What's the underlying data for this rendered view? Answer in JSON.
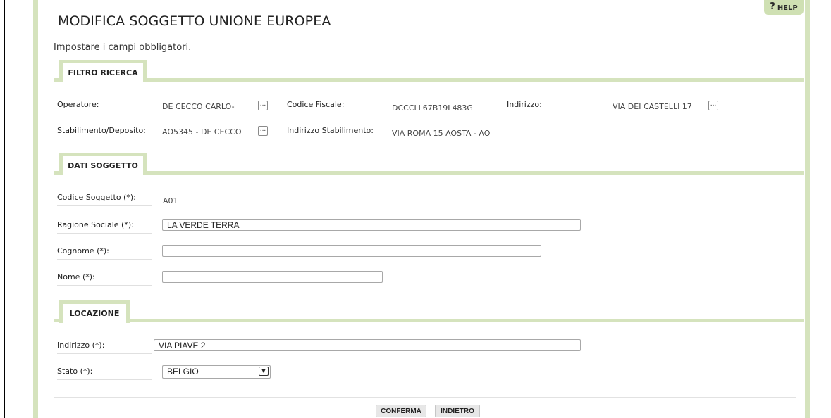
{
  "page": {
    "title": "MODIFICA SOGGETTO UNIONE EUROPEA",
    "help_label": "HELP",
    "instructions": "Impostare i campi obbligatori."
  },
  "filtro": {
    "tab_label": "FILTRO RICERCA",
    "operatore_label": "Operatore:",
    "operatore_value": "DE CECCO CARLO-",
    "codice_fiscale_label": "Codice Fiscale:",
    "codice_fiscale_value": "DCCCLL67B19L483G",
    "indirizzo_label": "Indirizzo:",
    "indirizzo_value": "VIA DEI CASTELLI 17",
    "stabilimento_label": "Stabilimento/Deposito:",
    "stabilimento_value": "AO5345 - DE CECCO",
    "indirizzo_stab_label": "Indirizzo Stabilimento:",
    "indirizzo_stab_value": "VIA ROMA 15 AOSTA -  AO",
    "lookup_label": "..."
  },
  "soggetto": {
    "tab_label": "DATI SOGGETTO",
    "codice_label": "Codice Soggetto (*):",
    "codice_value": "A01",
    "ragione_label": "Ragione Sociale (*):",
    "ragione_value": "LA VERDE TERRA",
    "cognome_label": "Cognome (*):",
    "cognome_value": "",
    "nome_label": "Nome (*):",
    "nome_value": ""
  },
  "locazione": {
    "tab_label": "LOCAZIONE",
    "indirizzo_label": "Indirizzo (*):",
    "indirizzo_value": "VIA PIAVE 2",
    "stato_label": "Stato (*):",
    "stato_value": "BELGIO"
  },
  "actions": {
    "conferma": "CONFERMA",
    "indietro": "INDIETRO"
  },
  "colors": {
    "accent_green": "#d5e3bd",
    "button_gray": "#e7e7e7"
  },
  "icons": {
    "help": "question-mark",
    "lookup": "ellipsis",
    "dropdown": "chevron-down"
  }
}
